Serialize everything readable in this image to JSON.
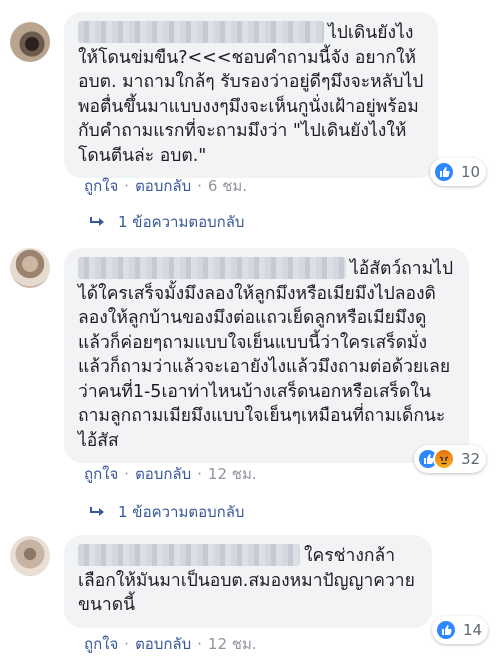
{
  "comments": [
    {
      "text": "ไปเดินยังไงให้โดนข่มขืน?<<<ชอบคำถามนี้จัง อยากให้อบต. มาถามใกล้ๆ รับรองว่าอยู่ดีๆมึงจะหลับไป พอตื่นขึ้นมาแบบงงๆมึงจะเห็นกูนั่งเฝ้าอยู่พร้อมกับคำถามแรกที่จะถามมึงว่า \"ไปเดินยังไงให้โดนตีนล่ะ อบต.\"",
      "like_label": "ถูกใจ",
      "reply_label": "ตอบกลับ",
      "time": "6 ชม.",
      "reaction_count": "10",
      "reaction_types": [
        "like"
      ],
      "replies_label": "1 ข้อความตอบกลับ"
    },
    {
      "text": "ไอ้สัตว์ถามไปได้ใครเสร็จมั้งมึงลองให้ลูกมึงหรือเมียมึงไปลองดิลองให้ลูกบ้านของมึงต่อแถวเย็ดลูกหรือเมียมึงดูแล้วก็ค่อยๆถามแบบใจเย็นแบบนี้ว่าใครเสร็ดมั่งแล้วก็ถามว่าแล้วจะเอายังไงแล้วมึงถามต่อด้วยเลยว่าคนที่1-5เอาท่าไหนบ้างเสร็ดนอกหรือเสร็ดในถามลูกถามเมียมึงแบบใจเย็นๆเหมือนที่ถามเด็กนะไอ้สัส",
      "like_label": "ถูกใจ",
      "reply_label": "ตอบกลับ",
      "time": "12 ชม.",
      "reaction_count": "32",
      "reaction_types": [
        "like",
        "angry"
      ],
      "replies_label": "1 ข้อความตอบกลับ"
    },
    {
      "text": "ใครช่างกล้าเลือกให้มันมาเป็นอบต.สมองหมาปัญญาควายขนาดนี้",
      "like_label": "ถูกใจ",
      "reply_label": "ตอบกลับ",
      "time": "12 ชม.",
      "reaction_count": "14",
      "reaction_types": [
        "like"
      ]
    }
  ],
  "colors": {
    "bubble_bg": "#f2f3f5",
    "link": "#385898",
    "meta": "#90949c",
    "like_blue": "#2d88ff"
  }
}
